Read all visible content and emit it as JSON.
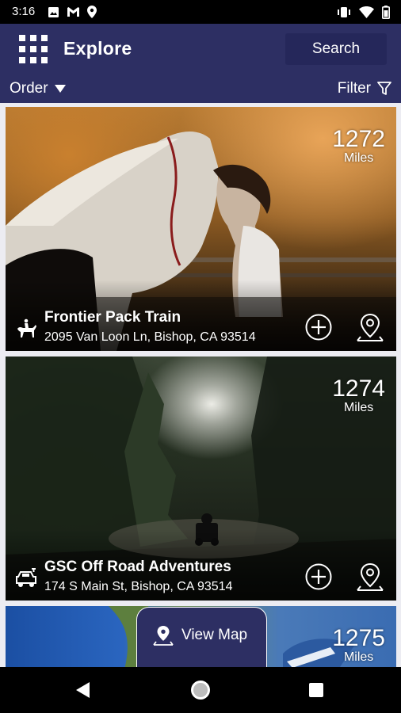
{
  "status_bar": {
    "time": "3:16",
    "left_icons": [
      "photo-icon",
      "gmail-icon",
      "location-icon"
    ],
    "right_icons": [
      "vibrate-icon",
      "wifi-icon",
      "battery-icon"
    ]
  },
  "app_bar": {
    "title": "Explore",
    "search_label": "Search"
  },
  "filter_bar": {
    "order_label": "Order",
    "filter_label": "Filter"
  },
  "cards": [
    {
      "name": "Frontier Pack Train",
      "address": "2095 Van Loon Ln, Bishop, CA 93514",
      "distance": "1272",
      "distance_unit": "Miles",
      "type_icon": "horse-rider-icon"
    },
    {
      "name": "GSC Off Road Adventures",
      "address": "174 S Main St, Bishop, CA 93514",
      "distance": "1274",
      "distance_unit": "Miles",
      "type_icon": "off-road-vehicle-icon"
    },
    {
      "name": "",
      "address": "",
      "distance": "1275",
      "distance_unit": "Miles",
      "type_icon": ""
    }
  ],
  "view_map": {
    "label": "View Map"
  },
  "colors": {
    "primary": "#2d2f63",
    "search_button": "#25275a",
    "list_background": "#ececf2"
  }
}
